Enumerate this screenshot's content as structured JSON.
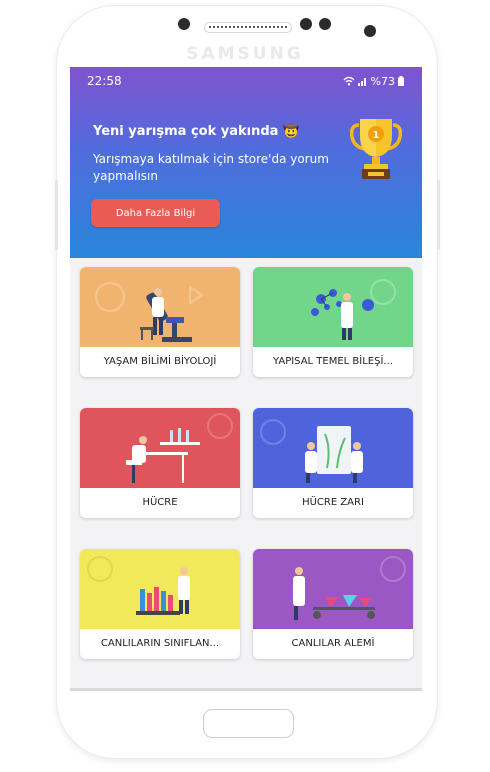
{
  "device": {
    "brand": "SAMSUNG"
  },
  "status_bar": {
    "time": "22:58",
    "battery": "%73",
    "icons": [
      "wifi-icon",
      "signal-icon",
      "battery-icon"
    ]
  },
  "promo": {
    "title": "Yeni yarışma çok yakında 🤠",
    "subtitle": "Yarışmaya katılmak için store'da yorum yapmalısın",
    "button_label": "Daha Fazla Bilgi",
    "trophy_number": "1"
  },
  "categories": [
    {
      "label": "YAŞAM BİLİMİ BİYOLOJİ",
      "color": "#f0b46e"
    },
    {
      "label": "YAPISAL TEMEL BİLEŞİ...",
      "color": "#72d68a"
    },
    {
      "label": "HÜCRE",
      "color": "#e0545c"
    },
    {
      "label": "HÜCRE ZARI",
      "color": "#4f63dd"
    },
    {
      "label": "CANLILARIN SINIFLAN...",
      "color": "#f2e95a"
    },
    {
      "label": "CANLILAR ALEMİ",
      "color": "#9b58c4"
    }
  ]
}
